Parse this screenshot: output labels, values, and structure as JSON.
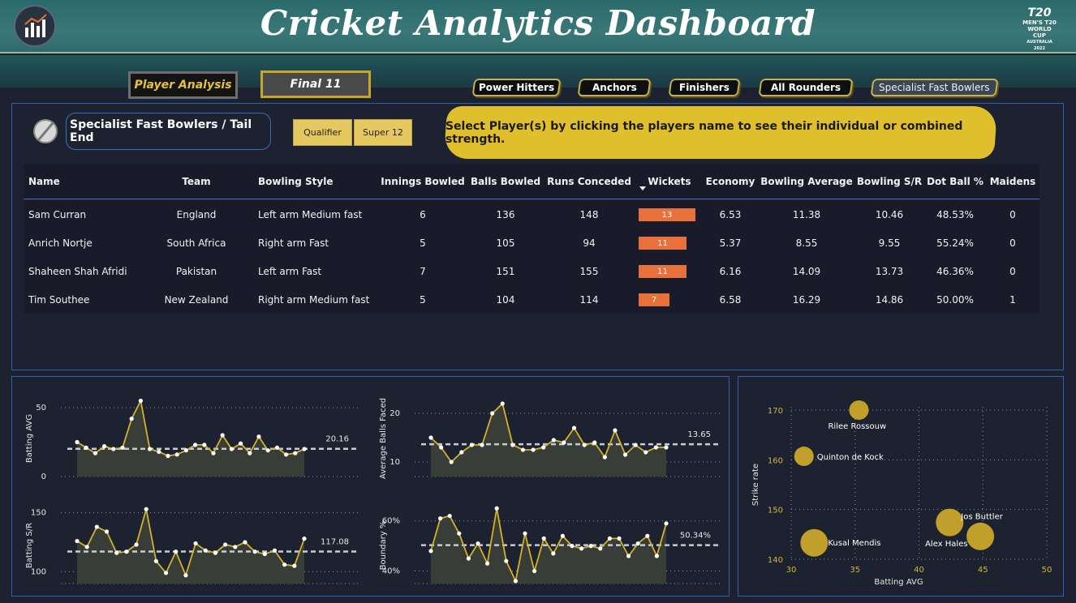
{
  "header": {
    "title": "Cricket Analytics Dashboard",
    "event_logo_text": [
      "T20",
      "MEN'S T20",
      "WORLD CUP",
      "AUSTRALIA 2022"
    ]
  },
  "nav": {
    "player_analysis": "Player Analysis",
    "final_11": "Final 11",
    "tabs": [
      "Power Hitters",
      "Anchors",
      "Finishers",
      "All Rounders",
      "Specialist Fast Bowlers"
    ],
    "active_tab": "Specialist Fast Bowlers"
  },
  "section": {
    "label": "Specialist Fast Bowlers / Tail End",
    "filters": [
      "Qualifier",
      "Super 12"
    ],
    "banner": "Select Player(s) by clicking the players name to see their individual or combined strength."
  },
  "table": {
    "columns": [
      "Name",
      "Team",
      "Bowling Style",
      "Innings Bowled",
      "Balls Bowled",
      "Runs Conceded",
      "Wickets",
      "Economy",
      "Bowling Average",
      "Bowling S/R",
      "Dot Ball %",
      "Maidens"
    ],
    "sorted_by": "Wickets",
    "rows": [
      [
        "Sam Curran",
        "England",
        "Left arm Medium fast",
        "6",
        "136",
        "148",
        "13",
        "6.53",
        "11.38",
        "10.46",
        "48.53%",
        "0"
      ],
      [
        "Anrich Nortje",
        "South Africa",
        "Right arm Fast",
        "5",
        "105",
        "94",
        "11",
        "5.37",
        "8.55",
        "9.55",
        "55.24%",
        "0"
      ],
      [
        "Shaheen Shah Afridi",
        "Pakistan",
        "Left arm Fast",
        "7",
        "151",
        "155",
        "11",
        "6.16",
        "14.09",
        "13.73",
        "46.36%",
        "0"
      ],
      [
        "Tim Southee",
        "New Zealand",
        "Right arm Medium fast",
        "5",
        "104",
        "114",
        "7",
        "6.58",
        "16.29",
        "14.86",
        "50.00%",
        "1"
      ]
    ],
    "wickets_max": 13
  },
  "colors": {
    "accent_gold": "#d4b12a",
    "bar_orange": "#e8703a",
    "panel_border": "#2e5fa8",
    "header_teal": "#2f6b6b"
  },
  "chart_data": [
    {
      "type": "line",
      "title": "",
      "ylabel": "Batting AVG",
      "ylim": [
        0,
        60
      ],
      "yticks": [
        0,
        50
      ],
      "reference_label": "20.16",
      "reference_value": 20.16,
      "values": [
        25,
        21,
        17,
        22,
        20,
        21,
        42,
        55,
        20,
        18,
        15,
        16,
        19,
        23,
        23,
        17,
        30,
        20,
        24,
        17,
        29,
        19,
        21,
        16,
        17,
        20
      ]
    },
    {
      "type": "line",
      "title": "",
      "ylabel": "Average Balls Faced",
      "ylim": [
        7,
        24
      ],
      "yticks": [
        10,
        20
      ],
      "reference_label": "13.65",
      "reference_value": 13.65,
      "values": [
        15,
        13,
        10,
        12,
        13.5,
        13.5,
        20,
        22,
        13.5,
        12.5,
        12.5,
        13,
        14.5,
        14,
        17,
        13.5,
        14,
        11,
        16.5,
        11.5,
        13.5,
        12,
        13,
        13
      ]
    },
    {
      "type": "line",
      "title": "",
      "ylabel": "Batting S/R",
      "ylim": [
        90,
        160
      ],
      "yticks": [
        100,
        150
      ],
      "reference_label": "117.08",
      "reference_value": 117.08,
      "values": [
        126,
        121,
        138,
        134,
        116,
        117,
        123,
        153,
        109,
        99,
        117,
        97,
        124,
        118,
        116,
        123,
        121,
        125,
        117,
        115,
        118,
        106,
        105,
        128
      ]
    },
    {
      "type": "line",
      "title": "",
      "ylabel": "Boundary %",
      "ylim": [
        35,
        68
      ],
      "yticks": [
        "40%",
        "60%"
      ],
      "reference_label": "50.34%",
      "reference_value": 50.34,
      "values": [
        48,
        61,
        62,
        55,
        45,
        51,
        43,
        65,
        44,
        36,
        55,
        40,
        53,
        47,
        54,
        50,
        49,
        50,
        49,
        53,
        53,
        46,
        51,
        54,
        46,
        59
      ]
    },
    {
      "type": "scatter",
      "title": "",
      "xlabel": "Batting AVG",
      "ylabel": "Strike rate",
      "xlim": [
        30,
        50
      ],
      "ylim": [
        140,
        170
      ],
      "xticks": [
        30,
        35,
        40,
        45,
        50
      ],
      "yticks": [
        140,
        150,
        160,
        170
      ],
      "points": [
        {
          "label": "Rilee Rossouw",
          "x": 35.3,
          "y": 170.0,
          "size": 1
        },
        {
          "label": "Quinton de Kock",
          "x": 31.0,
          "y": 160.7,
          "size": 1
        },
        {
          "label": "Jos Buttler",
          "x": 42.4,
          "y": 147.4,
          "size": 2
        },
        {
          "label": "Alex Hales",
          "x": 44.8,
          "y": 144.6,
          "size": 2
        },
        {
          "label": "Kusal Mendis",
          "x": 31.8,
          "y": 143.3,
          "size": 2
        }
      ]
    }
  ]
}
